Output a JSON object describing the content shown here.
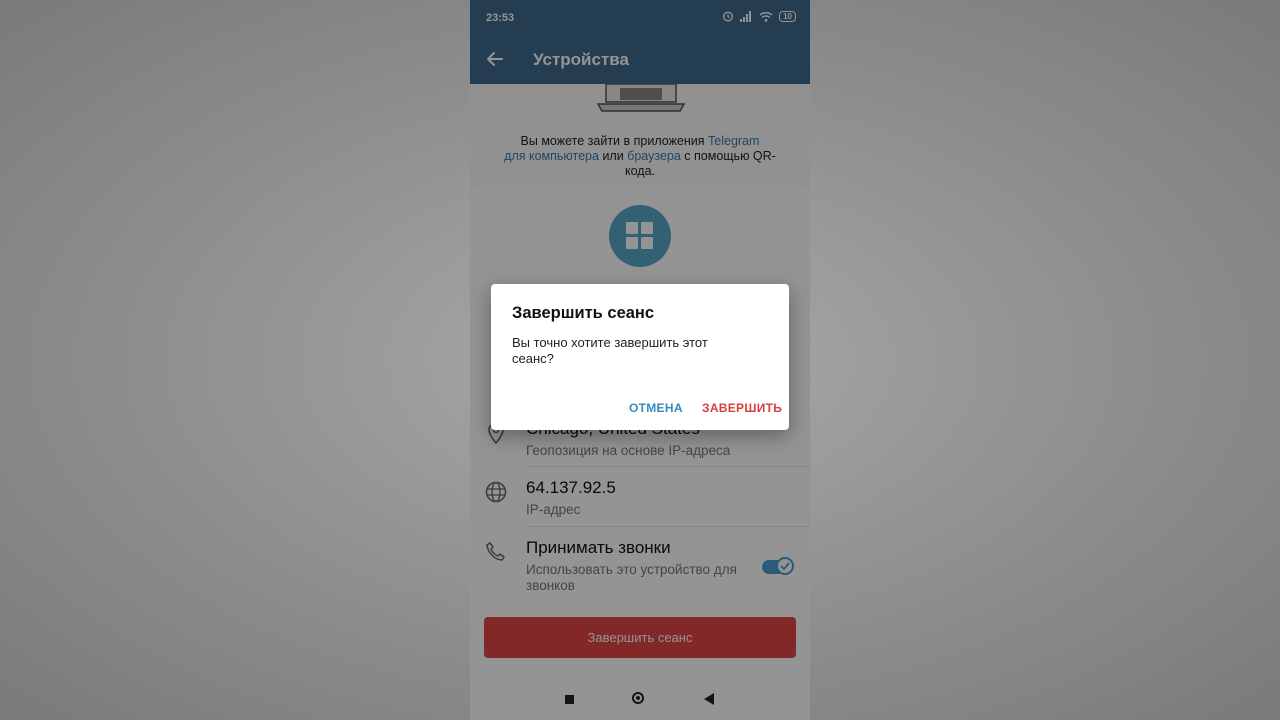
{
  "status_bar": {
    "time": "23:53",
    "battery": "10"
  },
  "app_bar": {
    "title": "Устройства"
  },
  "qr_hint": {
    "text_before": "Вы можете зайти в приложения ",
    "link_telegram": "Telegram",
    "link_desktop": "для компьютера",
    "text_or": " или ",
    "link_browser": "браузера",
    "text_after": " с помощью QR-кода."
  },
  "session": {
    "location": "Chicago, United States",
    "location_sub": "Геопозиция на основе IP-адреса",
    "ip": "64.137.92.5",
    "ip_sub": "IP-адрес",
    "calls_title": "Принимать звонки",
    "calls_sub": "Использовать это устройство для звонков",
    "calls_enabled": true,
    "end_button": "Завершить сеанс"
  },
  "dialog": {
    "title": "Завершить сеанс",
    "message": "Вы точно хотите завершить этот сеанс?",
    "cancel": "ОТМЕНА",
    "confirm": "ЗАВЕРШИТЬ"
  },
  "colors": {
    "header": "#3e6a8a",
    "accent": "#58a6c7",
    "danger": "#e04545",
    "link": "#3a7ab0"
  }
}
